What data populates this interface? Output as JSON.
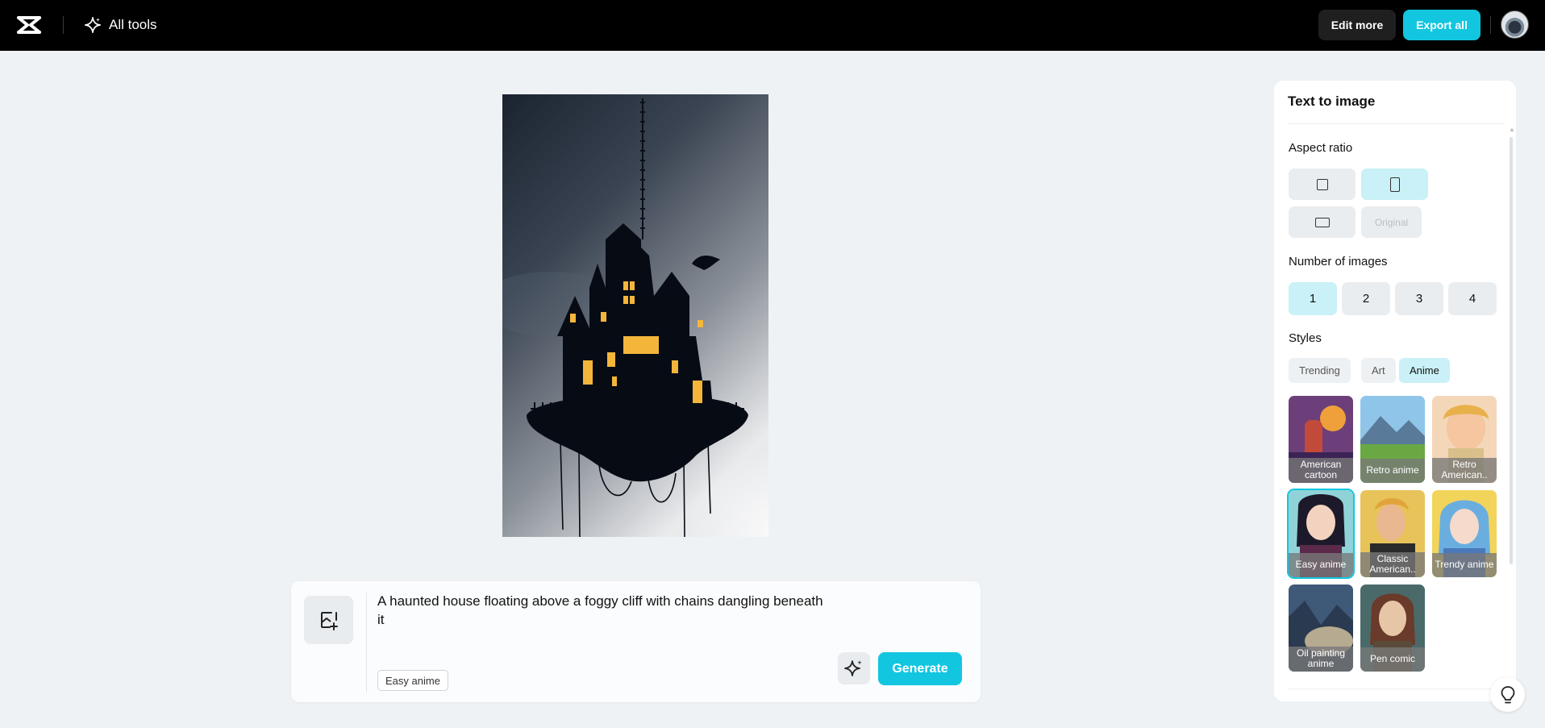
{
  "header": {
    "all_tools_label": "All tools",
    "edit_more_label": "Edit more",
    "export_all_label": "Export all",
    "accent_color": "#12c6e0"
  },
  "prompt": {
    "text": "A haunted house floating above a foggy cliff with chains dangling beneath it",
    "style_chip": "Easy anime",
    "generate_label": "Generate"
  },
  "side_panel": {
    "title": "Text to image",
    "aspect_ratio": {
      "label": "Aspect ratio",
      "options": [
        "square",
        "portrait",
        "landscape",
        "Original"
      ],
      "selected": "portrait"
    },
    "number_of_images": {
      "label": "Number of images",
      "options": [
        "1",
        "2",
        "3",
        "4"
      ],
      "selected": "1"
    },
    "styles": {
      "label": "Styles",
      "tabs": [
        "Trending",
        "Art",
        "Anime"
      ],
      "active_tab": "Anime",
      "cards": [
        {
          "label": "American cartoon"
        },
        {
          "label": "Retro anime"
        },
        {
          "label": "Retro American.."
        },
        {
          "label": "Easy anime"
        },
        {
          "label": "Classic American.."
        },
        {
          "label": "Trendy anime"
        },
        {
          "label": "Oil painting anime"
        },
        {
          "label": "Pen comic"
        }
      ],
      "selected": "Easy anime"
    }
  }
}
